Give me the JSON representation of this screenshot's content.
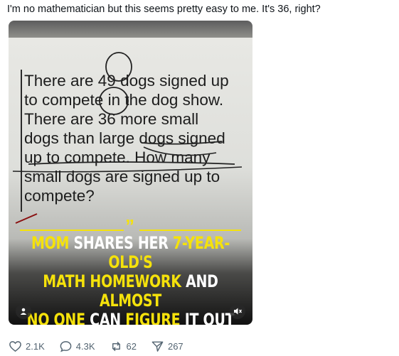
{
  "post": {
    "text": "I'm no mathematician but this seems pretty easy to me. It's 36, right?"
  },
  "media": {
    "problem_lines": [
      "There are 49 dogs signed up",
      "to compete in the dog show.",
      "There are 36 more small",
      "dogs than large dogs signed",
      "up to compete. How many",
      "small dogs are signed up to",
      "compete?"
    ],
    "headline": {
      "w1": "MOM",
      "w2": " SHARES HER ",
      "w3": "7-YEAR-OLD'S",
      "w4": "MATH HOMEWORK",
      "w5": " AND ",
      "w6": "ALMOST",
      "w7": "NO ONE",
      "w8": " CAN ",
      "w9": "FIGURE",
      "w10": " IT OUT"
    },
    "user_icon": "person-icon",
    "mute_icon": "muted-speaker-icon"
  },
  "actions": {
    "likes": "2.1K",
    "replies": "4.3K",
    "reposts": "62",
    "shares": "267"
  },
  "colors": {
    "accent_yellow": "#f5e20b",
    "meta_gray": "#536471"
  }
}
